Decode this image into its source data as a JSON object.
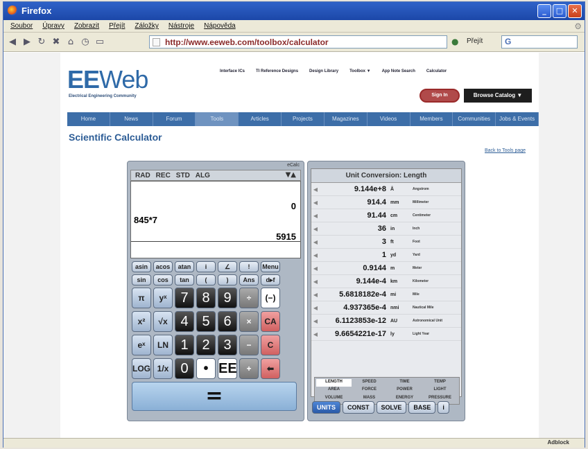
{
  "window": {
    "title": "Firefox"
  },
  "menu": [
    "Soubor",
    "Úpravy",
    "Zobrazit",
    "Přejít",
    "Záložky",
    "Nástroje",
    "Nápověda"
  ],
  "address": {
    "url": "http://www.eeweb.com/toolbox/calculator",
    "go_label": "Přejít",
    "search_text": "G"
  },
  "site": {
    "logo_ee": "EE",
    "logo_web": "Web",
    "tagline": "Electrical Engineering Community",
    "top_links": [
      "Interface ICs",
      "TI Reference Designs",
      "Design Library",
      "Toolbox ▼",
      "App Note Search",
      "Calculator"
    ],
    "sign_in": "Sign In",
    "browse_catalog": "Browse Catalog ▼",
    "nav_tabs": [
      "Home",
      "News",
      "Forum",
      "Tools",
      "Articles",
      "Projects",
      "Magazines",
      "Videos",
      "Members",
      "Communities",
      "Jobs & Events"
    ],
    "page_title": "Scientific Calculator",
    "back_link": "Back to Tools page"
  },
  "calculator": {
    "brand": "eCalc",
    "modes": [
      "RAD",
      "REC",
      "STD",
      "ALG"
    ],
    "mode_arrows": "▼▲",
    "display": {
      "top": "0",
      "expression": "845*7",
      "result": "5915"
    },
    "rows_small": [
      [
        "asin",
        "acos",
        "atan",
        "i",
        "∠",
        "!",
        "Menu"
      ],
      [
        "sin",
        "cos",
        "tan",
        "(",
        ")",
        "Ans",
        "d▸f"
      ]
    ],
    "rows_big": [
      [
        "π",
        "yˣ",
        "7",
        "8",
        "9",
        "÷",
        "(−)"
      ],
      [
        "x²",
        "√x",
        "4",
        "5",
        "6",
        "×",
        "CA"
      ],
      [
        "eˣ",
        "LN",
        "1",
        "2",
        "3",
        "−",
        "C"
      ],
      [
        "LOG",
        "1/x",
        "0",
        "•",
        "EE",
        "+",
        "⬅"
      ]
    ],
    "equals": "="
  },
  "units": {
    "title": "Unit Conversion: Length",
    "rows": [
      {
        "value": "9.144e+8",
        "abbr": "Å",
        "name": "Angstrom"
      },
      {
        "value": "914.4",
        "abbr": "mm",
        "name": "Millimeter"
      },
      {
        "value": "91.44",
        "abbr": "cm",
        "name": "Centimeter"
      },
      {
        "value": "36",
        "abbr": "in",
        "name": "Inch"
      },
      {
        "value": "3",
        "abbr": "ft",
        "name": "Foot"
      },
      {
        "value": "1",
        "abbr": "yd",
        "name": "Yard"
      },
      {
        "value": "0.9144",
        "abbr": "m",
        "name": "Meter"
      },
      {
        "value": "9.144e-4",
        "abbr": "km",
        "name": "Kilometer"
      },
      {
        "value": "5.6818182e-4",
        "abbr": "mi",
        "name": "Mile"
      },
      {
        "value": "4.937365e-4",
        "abbr": "nmi",
        "name": "Nautical Mile"
      },
      {
        "value": "6.1123853e-12",
        "abbr": "AU",
        "name": "Astronomical Unit"
      },
      {
        "value": "9.6654221e-17",
        "abbr": "ly",
        "name": "Light Year"
      }
    ],
    "categories": [
      [
        "LENGTH",
        "SPEED",
        "TIME",
        "TEMP"
      ],
      [
        "AREA",
        "FORCE",
        "POWER",
        "LIGHT"
      ],
      [
        "VOLUME",
        "MASS",
        "ENERGY",
        "PRESSURE"
      ]
    ],
    "tabs": [
      "UNITS",
      "CONST",
      "SOLVE",
      "BASE",
      "i"
    ]
  },
  "status": {
    "adblock": "Adblock"
  }
}
